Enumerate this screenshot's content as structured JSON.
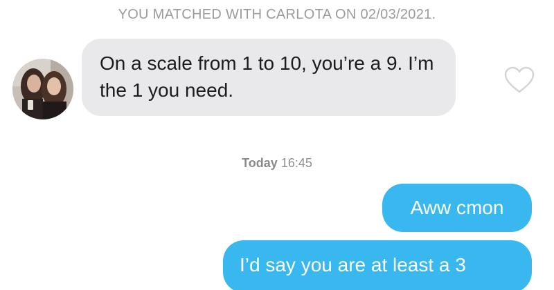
{
  "match_banner": "YOU MATCHED WITH CARLOTA ON 02/03/2021.",
  "messages": [
    {
      "direction": "incoming",
      "text": "On a scale from 1 to 10, you’re a 9. I’m the 1 you need.",
      "liked": false
    },
    {
      "direction": "outgoing",
      "text": "Aww cmon"
    },
    {
      "direction": "outgoing",
      "text": "I’d say you are at least a 3"
    }
  ],
  "timestamp": {
    "day": "Today",
    "time": "16:45"
  },
  "icons": {
    "like": "heart-outline-icon",
    "avatar": "profile-photo"
  },
  "colors": {
    "incoming_bubble": "#e9e9ec",
    "outgoing_bubble": "#39b8f0",
    "banner_text": "#9b9b9b"
  }
}
